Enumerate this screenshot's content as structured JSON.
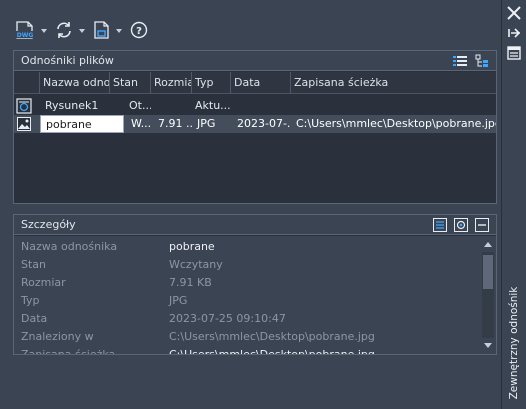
{
  "side": {
    "title": "Zewnętrzny odnośnik",
    "close_icon": "close-icon",
    "autohide_icon": "autohide-icon",
    "properties_icon": "properties-icon"
  },
  "toolbar": {
    "attach_dwg_icon": "attach-dwg-icon",
    "attach_dwg_text": "DWG",
    "refresh_icon": "refresh-icon",
    "change_path_icon": "change-path-icon",
    "help_icon": "help-icon",
    "help_glyph": "?"
  },
  "file_refs": {
    "title": "Odnośniki plików",
    "list_view_icon": "list-view-icon",
    "tree_view_icon": "tree-view-icon",
    "columns": [
      "Nazwa odnośn",
      "Stan",
      "Rozmiar",
      "Typ",
      "Data",
      "Zapisana ścieżka"
    ],
    "rows": [
      {
        "icon": "drawing-icon",
        "name": "Rysunek1",
        "status": "Ot...",
        "size": "",
        "type": "Aktu...",
        "date": "",
        "path": ""
      },
      {
        "icon": "image-icon",
        "name": "pobrane",
        "status": "W...",
        "size": "7.91 ...",
        "type": "JPG",
        "date": "2023-07-...",
        "path": "C:\\Users\\mmlec\\Desktop\\pobrane.jpg"
      }
    ]
  },
  "details": {
    "title": "Szczegóły",
    "details_view_icon": "details-view-icon",
    "preview_icon": "preview-icon",
    "collapse_icon": "collapse-icon",
    "rows": [
      {
        "label": "Nazwa odnośnika",
        "value": "pobrane"
      },
      {
        "label": "Stan",
        "value": "Wczytany"
      },
      {
        "label": "Rozmiar",
        "value": "7.91 KB"
      },
      {
        "label": "Typ",
        "value": "JPG"
      },
      {
        "label": "Data",
        "value": "2023-07-25 09:10:47"
      },
      {
        "label": "Znaleziony w",
        "value": "C:\\Users\\mmlec\\Desktop\\pobrane.jpg"
      },
      {
        "label": "Zapisana ścieżka",
        "value": "C:\\Users\\mmlec\\Desktop\\pobrane.jpg"
      }
    ]
  }
}
